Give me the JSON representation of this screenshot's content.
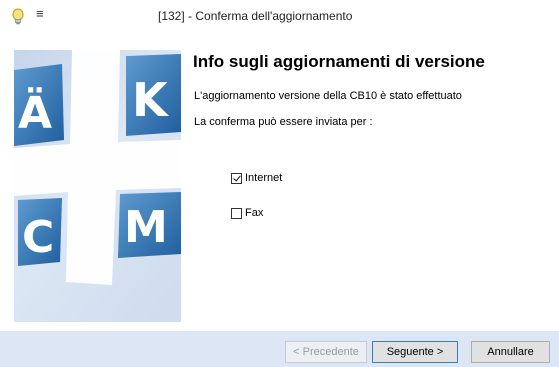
{
  "window": {
    "title": "[132] - Conferma dell'aggiornamento",
    "menu_glyph": "≡"
  },
  "side": {
    "letters": [
      "Ä",
      "K",
      "C",
      "M"
    ],
    "accent": "#2f78b8"
  },
  "content": {
    "heading": "Info sugli aggiornamenti di versione",
    "line1": "L'aggiornamento versione della CB10 è stato effettuato",
    "line2": "La conferma può essere inviata per :"
  },
  "options": [
    {
      "label": "Internet",
      "checked": true
    },
    {
      "label": "Fax",
      "checked": false
    }
  ],
  "buttons": {
    "back": "< Precedente",
    "next": "Seguente >",
    "cancel": "Annullare"
  }
}
